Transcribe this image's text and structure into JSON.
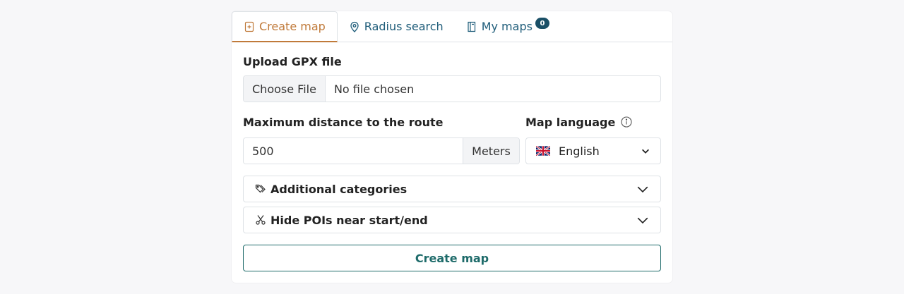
{
  "tabs": [
    {
      "label": "Create map",
      "icon": "file-plus-icon",
      "active": true
    },
    {
      "label": "Radius search",
      "icon": "map-pin-icon"
    },
    {
      "label": "My maps",
      "icon": "book-icon",
      "badge": "0"
    }
  ],
  "upload": {
    "label": "Upload GPX file",
    "button": "Choose File",
    "status": "No file chosen"
  },
  "distance": {
    "label": "Maximum distance to the route",
    "value": "500",
    "unit": "Meters"
  },
  "language": {
    "label": "Map language",
    "selected": "English",
    "flag": "uk-flag-icon"
  },
  "accordions": [
    {
      "label": "Additional categories",
      "icon": "tags-icon"
    },
    {
      "label": "Hide POIs near start/end",
      "icon": "scissors-icon"
    }
  ],
  "submit": {
    "label": "Create map"
  },
  "colors": {
    "accent": "#c07a3a",
    "tab_text": "#1f5d7a",
    "badge": "#1a4f66",
    "button": "#1e6b6a"
  }
}
